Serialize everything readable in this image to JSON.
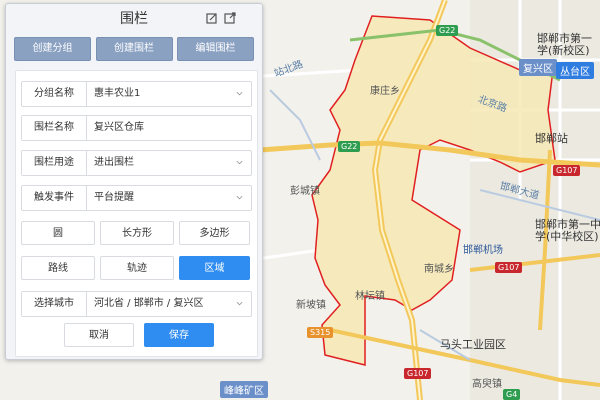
{
  "panel": {
    "title": "围栏",
    "top_buttons": {
      "create_group": "创建分组",
      "create_fence": "创建围栏",
      "edit_fence": "编辑围栏"
    },
    "fields": {
      "group_name": {
        "label": "分组名称",
        "value": "惠丰农业1"
      },
      "fence_name": {
        "label": "围栏名称",
        "value": "复兴区仓库"
      },
      "fence_use": {
        "label": "围栏用途",
        "value": "进出围栏"
      },
      "trigger_event": {
        "label": "触发事件",
        "value": "平台提醒"
      },
      "city": {
        "label": "选择城市",
        "value": "河北省 / 邯郸市 / 复兴区"
      }
    },
    "shape_options": {
      "circle": "圆",
      "rectangle": "长方形",
      "polygon": "多边形",
      "route": "路线",
      "track": "轨迹",
      "region": "区域"
    },
    "active_shape": "region",
    "cancel_label": "取消",
    "save_label": "保存"
  },
  "map": {
    "labels": {
      "hospital_1": "邯郸市第一",
      "hospital_1b": "学(新校区)",
      "fuxing": "复兴区",
      "congtai": "丛台区",
      "kangzhuang": "康庄乡",
      "handan_station": "邯郸站",
      "zhongxue": "邯郸市第一中",
      "zhongxue_b": "学(中华校区)",
      "airport": "邯郸机场",
      "pengcheng": "彭城镇",
      "nanchengxiang": "南城乡",
      "linzhuang": "林坛镇",
      "xinpo": "新坡镇",
      "matou": "马头工业园区",
      "fengfeng": "峰峰矿区",
      "gaojiao": "高臾镇",
      "road_handan": "邯郸大道",
      "road_beijing": "北京路",
      "road_zhanbei": "站北路"
    },
    "shields": {
      "g22a": "G22",
      "g22b": "G22",
      "g107a": "G107",
      "g107b": "G107",
      "g107c": "G107",
      "s315": "S315",
      "g4": "G4"
    },
    "colors": {
      "fence_fill": "#f6e9b5",
      "fence_border": "#e02020",
      "active_blue": "#2f8cf0",
      "top_button": "#8aa1c2"
    }
  }
}
